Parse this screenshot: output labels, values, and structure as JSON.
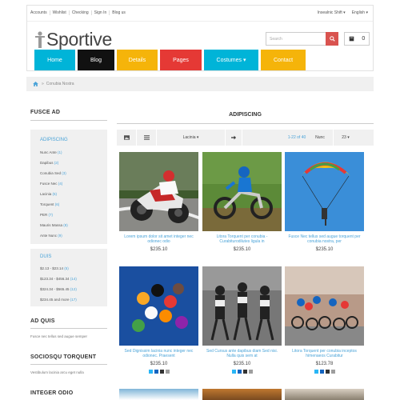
{
  "top_links": [
    "Accounts",
    "Wishlist",
    "Checking",
    "Sign In",
    "Blog us"
  ],
  "top_right": [
    "Insealnic Shift ▾",
    "English ▾"
  ],
  "logo_text": "Sportive",
  "search": {
    "placeholder": "Search"
  },
  "cart": {
    "count": "0"
  },
  "nav": [
    {
      "label": "Home",
      "color": "#00b4d8"
    },
    {
      "label": "Blog",
      "color": "#111111"
    },
    {
      "label": "Details",
      "color": "#f5b40a"
    },
    {
      "label": "Pages",
      "color": "#e53935"
    },
    {
      "label": "Costumes ▾",
      "color": "#00b4d8"
    },
    {
      "label": "Contact",
      "color": "#f5b40a"
    }
  ],
  "breadcrumb": {
    "current": "Conubia Nostra"
  },
  "sidebar": {
    "section1": "FUSCE AD",
    "box1_title": "ADIPISCING",
    "categories": [
      {
        "name": "Nunc Ante",
        "count": "(1)"
      },
      {
        "name": "Dapibus",
        "count": "(2)"
      },
      {
        "name": "Conubia Sed",
        "count": "(3)"
      },
      {
        "name": "Fusce Nec",
        "count": "(4)"
      },
      {
        "name": "Lacinia",
        "count": "(5)"
      },
      {
        "name": "Torquent",
        "count": "(6)"
      },
      {
        "name": "PER",
        "count": "(7)"
      },
      {
        "name": "Mauris Massa",
        "count": "(8)"
      },
      {
        "name": "Ante Nunc",
        "count": "(9)"
      }
    ],
    "box2_title": "DUIS",
    "prices": [
      {
        "range": "$2.13 - $23.14",
        "count": "(5)"
      },
      {
        "range": "$123.34 - $456.34",
        "count": "(14)"
      },
      {
        "range": "$324.34 - $565.45",
        "count": "(12)"
      },
      {
        "range": "$234.45 and more",
        "count": "(17)"
      }
    ],
    "section2": "AD QUIS",
    "section2_text": "Fusce nec tellus sed augue semper",
    "section3": "SOCIOSQU TORQUENT",
    "section3_text": "Vestibulum lacinia arcu eget nulla",
    "section4": "INTEGER ODIO"
  },
  "main": {
    "title": "ADIPISCING",
    "sort_label": "Lacinia ▾",
    "results": "1-22 of 40",
    "nunc_label": "Nunc",
    "per_page": "23 ▾"
  },
  "products": [
    {
      "name": "Lorem ipsum dolor sit amet integer nec odionec odio",
      "price": "$235.10",
      "icon": "motorcycle-racer-image"
    },
    {
      "name": "Litora Torquent per conubia - Curabiturodilutes ligula in",
      "price": "$235.10",
      "icon": "dirt-bike-image"
    },
    {
      "name": "Fusce Nec tellus sed augue torquent per conubia nostra, per",
      "price": "$235.10",
      "icon": "parachute-image"
    },
    {
      "name": "Sed Dignissim lacinia nunc integer nec odionec. Praesent",
      "price": "$235.10",
      "icon": "billiards-image"
    },
    {
      "name": "Sed Cursus ante dapibus diam Sed nisi. Nulla quis sem at",
      "price": "$235.10",
      "icon": "runners-image"
    },
    {
      "name": "Litora Torquent per conubia inceptos himenaeos Curabitur",
      "price": "$123.78",
      "icon": "cyclists-image"
    }
  ]
}
